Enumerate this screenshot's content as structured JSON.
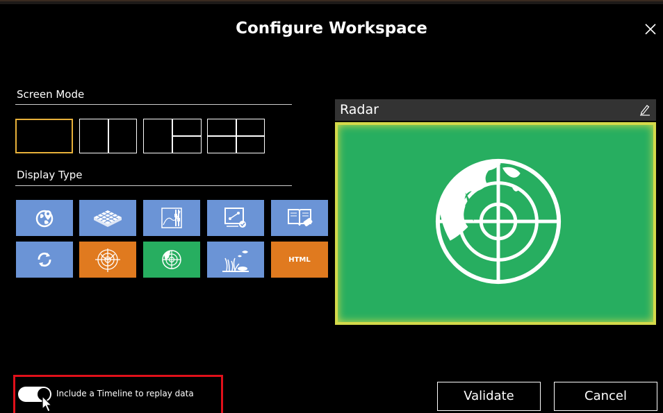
{
  "dialog": {
    "title": "Configure Workspace",
    "close_icon": "close-icon"
  },
  "screen_mode": {
    "label": "Screen Mode",
    "options": [
      "single",
      "two-columns",
      "one-plus-two",
      "four-grid"
    ],
    "selected": "single",
    "selected_color": "#e8b13a"
  },
  "display_type": {
    "label": "Display Type",
    "tiles": [
      {
        "icon": "map-globe-icon",
        "color": "#6b94d6"
      },
      {
        "icon": "3d-grid-icon",
        "color": "#6b94d6"
      },
      {
        "icon": "chart-plotter-icon",
        "color": "#6b94d6"
      },
      {
        "icon": "presentation-board-icon",
        "color": "#6b94d6"
      },
      {
        "icon": "manual-book-icon",
        "color": "#6b94d6"
      },
      {
        "icon": "refresh-cycle-icon",
        "color": "#6b94d6"
      },
      {
        "icon": "sonar-target-icon",
        "color": "#e07a1f"
      },
      {
        "icon": "radar-globe-icon",
        "color": "#27ae60"
      },
      {
        "icon": "fish-finder-icon",
        "color": "#6b94d6"
      },
      {
        "icon": "html-icon",
        "color": "#e07a1f",
        "label": "HTML"
      }
    ]
  },
  "preview": {
    "title": "Radar",
    "edit_icon": "pencil-icon",
    "background": "#27ae60",
    "border_color": "#d4d94a"
  },
  "timeline": {
    "label": "Include a Timeline to replay data",
    "enabled": true
  },
  "buttons": {
    "validate": "Validate",
    "cancel": "Cancel"
  }
}
